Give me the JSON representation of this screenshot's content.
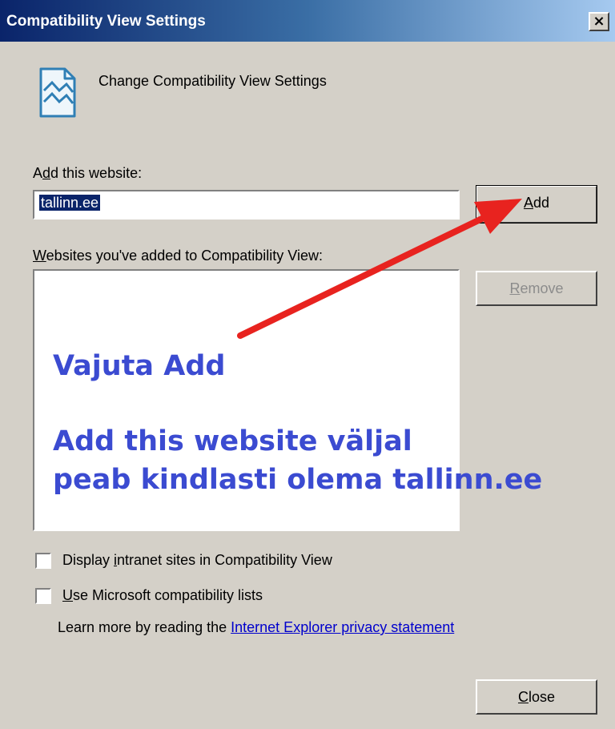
{
  "window": {
    "title": "Compatibility View Settings",
    "close_glyph": "×"
  },
  "header": {
    "text": "Change Compatibility View Settings",
    "icon": "compatibility-view-icon"
  },
  "add_site": {
    "label_prefix": "A",
    "label_access": "d",
    "label_rest": "d this website:",
    "value": "tallinn.ee",
    "button_access": "A",
    "button_rest": "dd"
  },
  "sites_list": {
    "label_access": "W",
    "label_rest": "ebsites you've added to Compatibility View:",
    "remove_access": "R",
    "remove_rest": "emove",
    "items": []
  },
  "annotation": {
    "line1": "Vajuta Add",
    "line2": "Add this website väljal",
    "line3": "peab kindlasti olema tallinn.ee",
    "text_color": "#3b4bd1",
    "arrow_color": "#e8231f"
  },
  "options": {
    "intranet_prefix": "Display ",
    "intranet_access": "i",
    "intranet_rest": "ntranet sites in Compatibility View",
    "intranet_checked": false,
    "mslists_access": "U",
    "mslists_rest": "se Microsoft compatibility lists",
    "mslists_checked": false
  },
  "learn_more": {
    "text": "Learn more by reading the ",
    "link": "Internet Explorer privacy statement"
  },
  "footer": {
    "close_access": "C",
    "close_rest": "lose"
  }
}
